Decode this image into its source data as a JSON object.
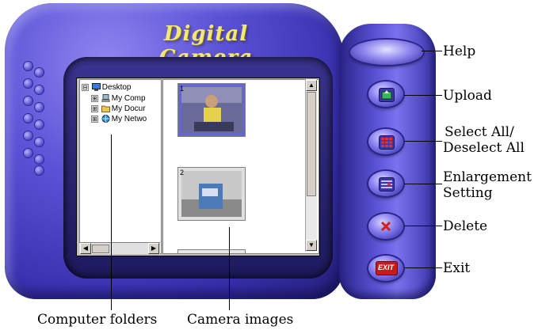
{
  "window": {
    "title": "Digital Camera"
  },
  "tree": {
    "items": [
      {
        "label": "Desktop",
        "expander": "⊟"
      },
      {
        "label": "My Comp",
        "expander": "⊞"
      },
      {
        "label": "My Docur",
        "expander": "⊞"
      },
      {
        "label": "My Netwo",
        "expander": "⊞"
      }
    ]
  },
  "images": [
    {
      "number": "1"
    },
    {
      "number": "2"
    }
  ],
  "buttons": {
    "help": "Help",
    "upload": "Upload",
    "select_all": "Select All/",
    "deselect_all": "Deselect All",
    "enlargement_1": "Enlargement",
    "enlargement_2": "Setting",
    "delete": "Delete",
    "exit": "Exit",
    "exit_icon_text": "EXIT"
  },
  "callouts": {
    "computer_folders": "Computer folders",
    "camera_images": "Camera images"
  },
  "colors": {
    "device_body": "#5b52d6",
    "title_text": "#f2e878",
    "delete_icon": "#d0201a"
  }
}
